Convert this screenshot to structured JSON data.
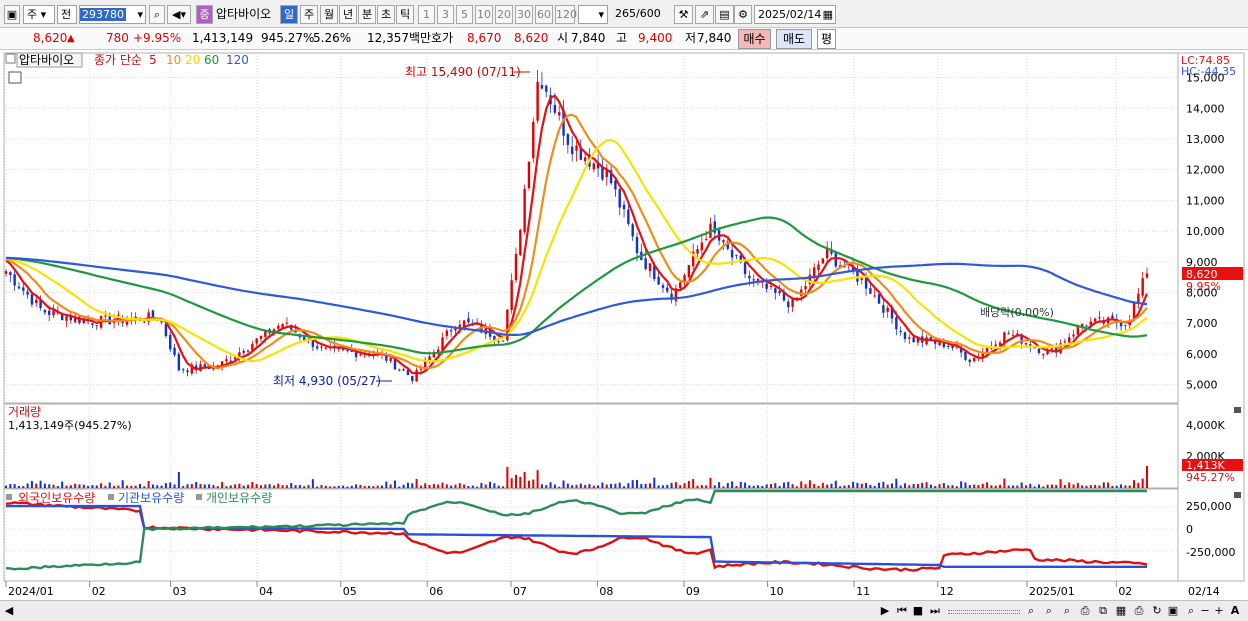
{
  "toolbar": {
    "market": "주",
    "prev_label": "전",
    "code": "293780",
    "stock_badge": "증",
    "stock_name": "압타바이오",
    "periods": [
      "일",
      "주",
      "월",
      "년",
      "분",
      "초",
      "틱"
    ],
    "intervals": [
      "1",
      "3",
      "5",
      "10",
      "20",
      "30",
      "60",
      "120"
    ],
    "count": "265",
    "count_max": "/600",
    "date": "2025/02/14"
  },
  "quote": {
    "price": "8,620",
    "arrow": "▲",
    "change": "780",
    "change_pct": "+9.95%",
    "volume": "1,413,149",
    "vol_ratio": "945.27%",
    "turnover": "5.26%",
    "amount": "12,357백만",
    "bid_label": "호가",
    "ask_price": "8,670",
    "bid_price": "8,620",
    "open_label": "시",
    "open": "7,840",
    "high_label": "고",
    "high": "9,400",
    "low_label": "저",
    "low": "7,840",
    "buy_button": "매수",
    "sell_button": "매도",
    "eval_button": "평"
  },
  "chart_data": {
    "type": "candlestick",
    "title": "압타바이오",
    "legend": {
      "price_label": "종가 단순",
      "ma": [
        {
          "period": "5",
          "color": "#e81010"
        },
        {
          "period": "10",
          "color": "#f08c18"
        },
        {
          "period": "20",
          "color": "#f5e400"
        },
        {
          "period": "60",
          "color": "#1e9a3c"
        },
        {
          "period": "120",
          "color": "#3058d8"
        }
      ]
    },
    "lc_label": "LC:74.85",
    "hc_label": "HC:-44.35",
    "price_ticks": [
      "15,000",
      "14,000",
      "13,000",
      "12,000",
      "11,000",
      "10,000",
      "9,000",
      "8,000",
      "7,000",
      "6,000",
      "5,000"
    ],
    "price_range": [
      4400,
      15800
    ],
    "last_price_label": "8,620",
    "last_change_label": "9.95%",
    "high_annotation": "최고 15,490 (07/11)",
    "low_annotation": "최저 4,930 (05/27)",
    "dividend_annotation": "배당락(0.00%)",
    "x_labels": [
      "2024/01",
      "02",
      "03",
      "04",
      "05",
      "06",
      "07",
      "08",
      "09",
      "10",
      "11",
      "12",
      "2025/01",
      "02",
      "02/14"
    ],
    "price_path": [
      [
        "2024-01-02",
        8700
      ],
      [
        "2024-01-15",
        7400
      ],
      [
        "2024-02-01",
        7050
      ],
      [
        "2024-02-26",
        7200
      ],
      [
        "2024-03-04",
        5500
      ],
      [
        "2024-03-18",
        5600
      ],
      [
        "2024-04-10",
        7000
      ],
      [
        "2024-04-25",
        6100
      ],
      [
        "2024-05-15",
        6000
      ],
      [
        "2024-05-27",
        5200
      ],
      [
        "2024-06-12",
        7100
      ],
      [
        "2024-06-28",
        6500
      ],
      [
        "2024-07-03",
        9200
      ],
      [
        "2024-07-11",
        15200
      ],
      [
        "2024-07-22",
        12900
      ],
      [
        "2024-08-05",
        11800
      ],
      [
        "2024-08-16",
        9200
      ],
      [
        "2024-08-28",
        7900
      ],
      [
        "2024-09-10",
        10100
      ],
      [
        "2024-09-25",
        8400
      ],
      [
        "2024-10-10",
        7600
      ],
      [
        "2024-10-22",
        9300
      ],
      [
        "2024-11-05",
        8300
      ],
      [
        "2024-11-20",
        6500
      ],
      [
        "2024-12-05",
        6300
      ],
      [
        "2024-12-13",
        5800
      ],
      [
        "2024-12-26",
        6700
      ],
      [
        "2025-01-10",
        6000
      ],
      [
        "2025-01-22",
        7000
      ],
      [
        "2025-02-07",
        7050
      ],
      [
        "2025-02-14",
        8620
      ]
    ],
    "volume": {
      "label": "거래량",
      "current": "1,413,149주(945.27%)",
      "ticks": [
        "4,000K",
        "2,000K"
      ],
      "last_label": "1,413K",
      "last_ratio": "945.27%",
      "max": 5000
    },
    "ownership": {
      "series": [
        {
          "name": "외국인보유수량",
          "color": "#e01010"
        },
        {
          "name": "기관보유수량",
          "color": "#2850d8"
        },
        {
          "name": "개인보유수량",
          "color": "#2e8b57"
        }
      ],
      "ticks": [
        "250,000",
        "0",
        "-250,000"
      ]
    }
  }
}
